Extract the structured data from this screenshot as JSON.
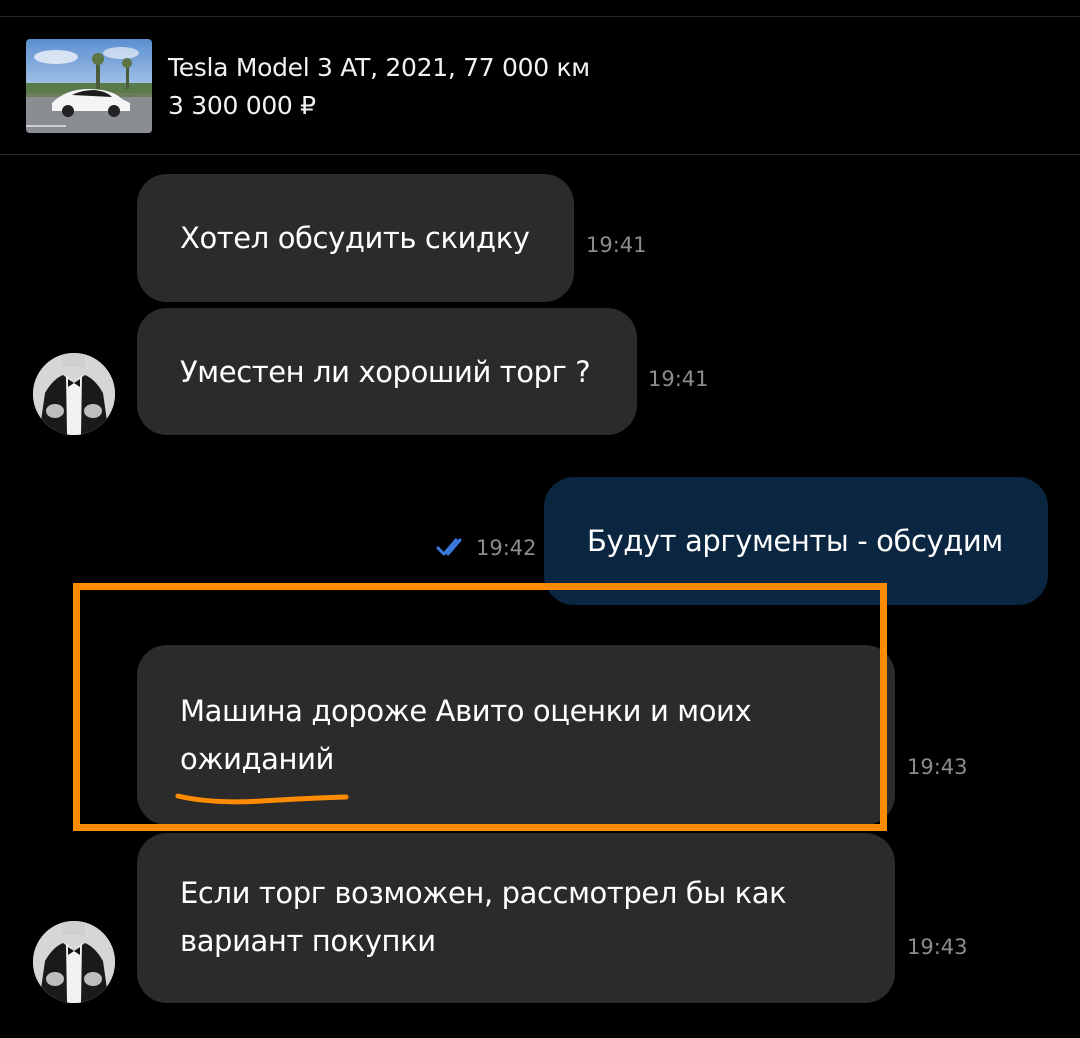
{
  "listing": {
    "title": "Tesla Model 3 AT, 2021, 77 000 км",
    "price": "3 300 000 ₽",
    "thumbnail_icon": "car-photo"
  },
  "messages": [
    {
      "direction": "incoming",
      "text": "Хотел обсудить скидку",
      "time": "19:41"
    },
    {
      "direction": "incoming",
      "text": "Уместен ли хороший торг ?",
      "time": "19:41"
    },
    {
      "direction": "outgoing",
      "text": "Будут аргументы - обсудим",
      "time": "19:42",
      "status_icon": "double-check-icon"
    },
    {
      "direction": "incoming",
      "text_lines": [
        "Машина дороже Авито оценки и моих",
        "ожиданий"
      ],
      "time": "19:43"
    },
    {
      "direction": "incoming",
      "text_lines": [
        "Если торг возможен, рассмотрел бы как",
        "вариант покупки"
      ],
      "time": "19:43"
    }
  ],
  "colors": {
    "background": "#000000",
    "incoming_bubble": "#2b2b2b",
    "outgoing_bubble": "#0b2640",
    "time_text": "#8c8c8c",
    "read_check": "#3d7be0",
    "annotation": "#ff8c00"
  },
  "annotation": {
    "type": "highlight-box-with-underline"
  }
}
